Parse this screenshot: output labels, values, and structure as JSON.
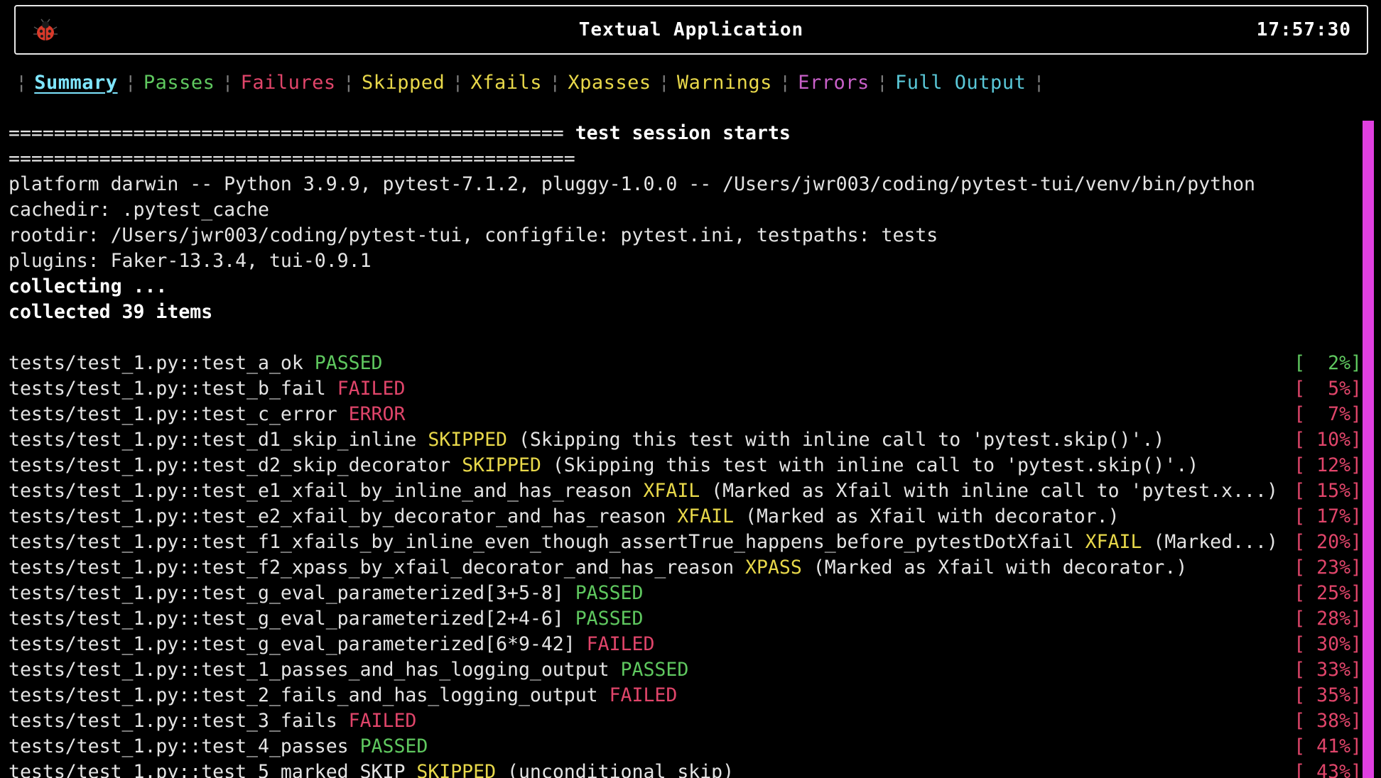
{
  "header": {
    "title": "Textual Application",
    "clock": "17:57:30",
    "icon": "ladybug-icon"
  },
  "tabs": [
    {
      "label": "Summary",
      "color": "#7fe6ff",
      "active": true
    },
    {
      "label": "Passes",
      "color": "#5fc85f"
    },
    {
      "label": "Failures",
      "color": "#e0456a"
    },
    {
      "label": "Skipped",
      "color": "#e8d84a"
    },
    {
      "label": "Xfails",
      "color": "#e8d84a"
    },
    {
      "label": "Xpasses",
      "color": "#e8d84a"
    },
    {
      "label": "Warnings",
      "color": "#e8d84a"
    },
    {
      "label": "Errors",
      "color": "#c860c8"
    },
    {
      "label": "Full Output",
      "color": "#5ac8d8"
    }
  ],
  "colors": {
    "passed": "#5fc85f",
    "failed": "#e0456a",
    "yellow": "#e8d84a",
    "scrollbar": "#e040e0"
  },
  "output": {
    "session_line": "================================================= test session starts",
    "session_line2": "==================================================",
    "platform": "platform darwin -- Python 3.9.9, pytest-7.1.2, pluggy-1.0.0 -- /Users/jwr003/coding/pytest-tui/venv/bin/python",
    "cachedir": "cachedir: .pytest_cache",
    "rootdir": "rootdir: /Users/jwr003/coding/pytest-tui, configfile: pytest.ini, testpaths: tests",
    "plugins": "plugins: Faker-13.3.4, tui-0.9.1",
    "collecting": "collecting ...",
    "collected": "collected 39 items",
    "results": [
      {
        "test": "tests/test_1.py::test_a_ok ",
        "status": "PASSED",
        "kind": "passed",
        "note": "",
        "pct": "[  2%]"
      },
      {
        "test": "tests/test_1.py::test_b_fail ",
        "status": "FAILED",
        "kind": "failed",
        "note": "",
        "pct": "[  5%]"
      },
      {
        "test": "tests/test_1.py::test_c_error ",
        "status": "ERROR",
        "kind": "failed",
        "note": "",
        "pct": "[  7%]"
      },
      {
        "test": "tests/test_1.py::test_d1_skip_inline ",
        "status": "SKIPPED",
        "kind": "yellow",
        "note": " (Skipping this test with inline call to 'pytest.skip()'.)",
        "pct": "[ 10%]"
      },
      {
        "test": "tests/test_1.py::test_d2_skip_decorator ",
        "status": "SKIPPED",
        "kind": "yellow",
        "note": " (Skipping this test with inline call to 'pytest.skip()'.)",
        "pct": "[ 12%]"
      },
      {
        "test": "tests/test_1.py::test_e1_xfail_by_inline_and_has_reason ",
        "status": "XFAIL",
        "kind": "yellow",
        "note": " (Marked as Xfail with inline call to 'pytest.x...)",
        "pct": "[ 15%]"
      },
      {
        "test": "tests/test_1.py::test_e2_xfail_by_decorator_and_has_reason ",
        "status": "XFAIL",
        "kind": "yellow",
        "note": " (Marked as Xfail with decorator.)",
        "pct": "[ 17%]"
      },
      {
        "test": "tests/test_1.py::test_f1_xfails_by_inline_even_though_assertTrue_happens_before_pytestDotXfail ",
        "status": "XFAIL",
        "kind": "yellow",
        "note": " (Marked...)",
        "pct": "[ 20%]"
      },
      {
        "test": "tests/test_1.py::test_f2_xpass_by_xfail_decorator_and_has_reason ",
        "status": "XPASS",
        "kind": "yellow",
        "note": " (Marked as Xfail with decorator.)",
        "pct": "[ 23%]"
      },
      {
        "test": "tests/test_1.py::test_g_eval_parameterized[3+5-8] ",
        "status": "PASSED",
        "kind": "passed",
        "note": "",
        "pct": "[ 25%]"
      },
      {
        "test": "tests/test_1.py::test_g_eval_parameterized[2+4-6] ",
        "status": "PASSED",
        "kind": "passed",
        "note": "",
        "pct": "[ 28%]"
      },
      {
        "test": "tests/test_1.py::test_g_eval_parameterized[6*9-42] ",
        "status": "FAILED",
        "kind": "failed",
        "note": "",
        "pct": "[ 30%]"
      },
      {
        "test": "tests/test_1.py::test_1_passes_and_has_logging_output ",
        "status": "PASSED",
        "kind": "passed",
        "note": "",
        "pct": "[ 33%]"
      },
      {
        "test": "tests/test_1.py::test_2_fails_and_has_logging_output ",
        "status": "FAILED",
        "kind": "failed",
        "note": "",
        "pct": "[ 35%]"
      },
      {
        "test": "tests/test_1.py::test_3_fails ",
        "status": "FAILED",
        "kind": "failed",
        "note": "",
        "pct": "[ 38%]"
      },
      {
        "test": "tests/test_1.py::test_4_passes ",
        "status": "PASSED",
        "kind": "passed",
        "note": "",
        "pct": "[ 41%]"
      },
      {
        "test": "tests/test_1.py::test_5_marked_SKIP ",
        "status": "SKIPPED",
        "kind": "yellow",
        "note": " (unconditional skip)",
        "pct": "[ 43%]"
      }
    ]
  }
}
